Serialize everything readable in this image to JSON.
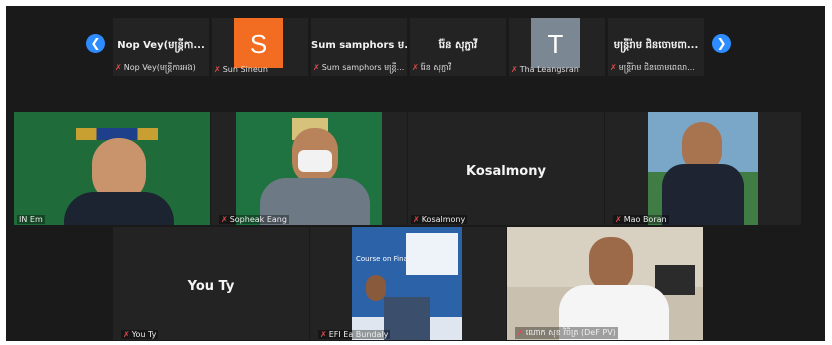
{
  "strip": {
    "thumbs": [
      {
        "title": "Nop Vey(មន្ត្រីកា...",
        "caption": "Nop Vey(មន្ត្រីការអង)"
      },
      {
        "avatar": "S",
        "caption": "Sun Sineun",
        "color": "#f26d21"
      },
      {
        "title": "Sum samphors ម...",
        "caption": "Sum samphors មន្ត្រី..."
      },
      {
        "title": "រ៉ែន សុភ្ជាវី",
        "caption": "រ៉ែន សុភ្ជាវី"
      },
      {
        "avatar": "T",
        "caption": "Tha Leangsran",
        "color": "#7b8792"
      },
      {
        "title": "មន្ត្រីរ៉ាម ជិនចោមពា...",
        "caption": "មន្ត្រីរ៉ាម ជិនចោមពេលា..."
      }
    ]
  },
  "tiles": [
    {
      "label": "IN Em"
    },
    {
      "label": "Sopheak Eang"
    },
    {
      "name": "Kosalmony",
      "label": "Kosalmony"
    },
    {
      "label": "Mao Boran"
    },
    {
      "name": "You Ty",
      "label": "You Ty"
    },
    {
      "label": "EFI Ea Bundaly",
      "slide_text": "Course on Finan..."
    },
    {
      "label": "ណោក សុខ វិចិត្រ (DeF PV)"
    }
  ],
  "colors": {
    "accent": "#2d8cff",
    "active_border": "#e6e25c",
    "muted_mic": "#e24b4b"
  }
}
